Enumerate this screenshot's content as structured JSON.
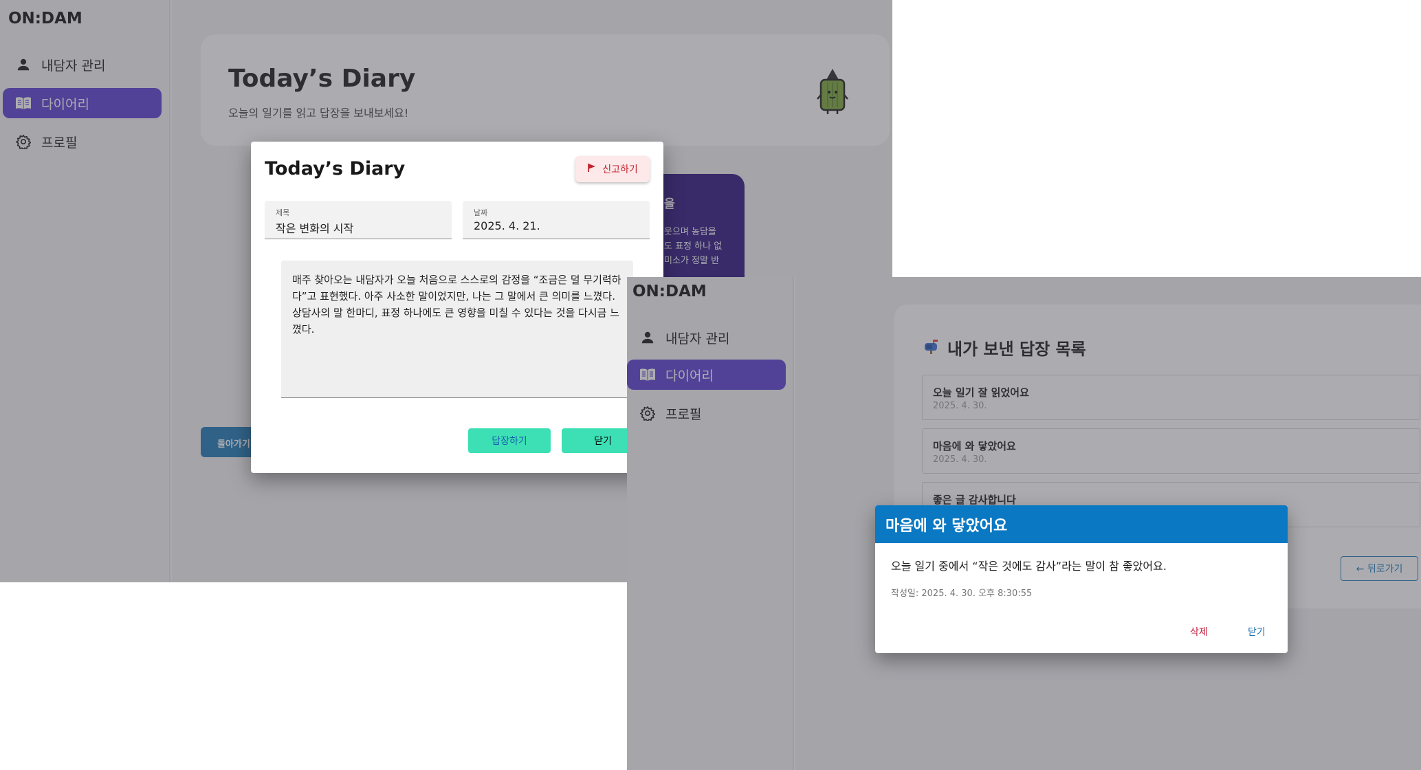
{
  "panel1": {
    "brand": "ON:DAM",
    "nav": [
      {
        "label": "내담자 관리",
        "icon": "person-icon"
      },
      {
        "label": "다이어리",
        "icon": "book-icon",
        "active": true
      },
      {
        "label": "프로필",
        "icon": "gear-icon"
      }
    ],
    "header": {
      "title": "Today’s Diary",
      "subtitle": "오늘의 일기를 읽고 답장을 보내보세요!"
    },
    "purple_card": {
      "heading": "을",
      "lines": [
        "웃으며 농담을",
        "도 표정 하나 없",
        "미소가 정말 반"
      ]
    },
    "back_button": "돌아가기",
    "modal": {
      "title": "Today’s Diary",
      "report_label": "신고하기",
      "title_field": {
        "label": "제목",
        "value": "작은 변화의 시작"
      },
      "date_field": {
        "label": "날짜",
        "value": "2025. 4. 21."
      },
      "content": "매주 찾아오는 내담자가 오늘 처음으로 스스로의 감정을 “조금은 덜 무기력하다”고 표현했다. 아주 사소한 말이었지만, 나는 그 말에서 큰 의미를 느꼈다. 상담사의 말 한마디, 표정 하나에도 큰 영향을 미칠 수 있다는 것을 다시금 느꼈다.",
      "reply_label": "답장하기",
      "close_label": "닫기"
    }
  },
  "panel2": {
    "brand": "ON:DAM",
    "nav": [
      {
        "label": "내담자 관리",
        "icon": "person-icon"
      },
      {
        "label": "다이어리",
        "icon": "book-icon",
        "active": true
      },
      {
        "label": "프로필",
        "icon": "gear-icon"
      }
    ],
    "list_title": "내가 보낸 답장 목록",
    "list_icon": "mailbox-icon",
    "replies": [
      {
        "title": "오늘 일기 잘 읽었어요",
        "date": "2025. 4. 30."
      },
      {
        "title": "마음에 와 닿았어요",
        "date": "2025. 4. 30."
      },
      {
        "title": "좋은 글 감사합니다",
        "date": ""
      }
    ],
    "back_label": "← 뒤로가기",
    "modal": {
      "title": "마음에 와 닿았어요",
      "body": "오늘 일기 중에서 “작은 것에도 감사”라는 말이 참 좋았어요.",
      "date": "작성일: 2025. 4. 30. 오후 8:30:55",
      "delete_label": "삭제",
      "close_label": "닫기"
    }
  },
  "colors": {
    "accent": "#5b3fd1",
    "mint": "#3ce0b4",
    "blue": "#0a78c2",
    "danger": "#c41b3a"
  }
}
